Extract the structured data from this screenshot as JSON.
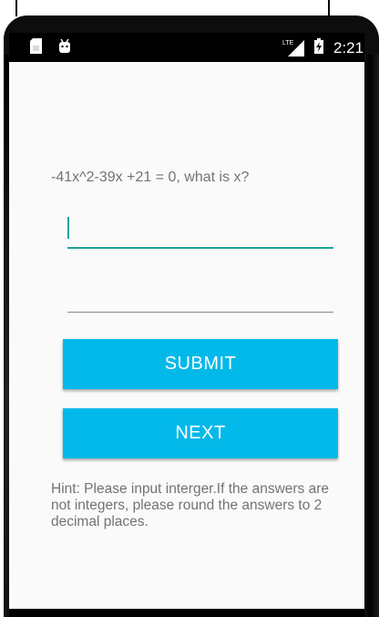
{
  "status_bar": {
    "network": "LTE",
    "time": "2:21"
  },
  "question": {
    "text": "-41x^2-39x +21 = 0, what is x?"
  },
  "inputs": {
    "answer_1_value": "",
    "answer_2_value": ""
  },
  "buttons": {
    "submit_label": "SUBMIT",
    "next_label": "NEXT"
  },
  "hint": {
    "text": "Hint: Please input interger.If the answers are not integers, please round the answers to 2 decimal places."
  },
  "colors": {
    "accent": "#1aa39a",
    "button": "#03b9ea",
    "text_secondary": "#737373",
    "background": "#fafafa"
  }
}
